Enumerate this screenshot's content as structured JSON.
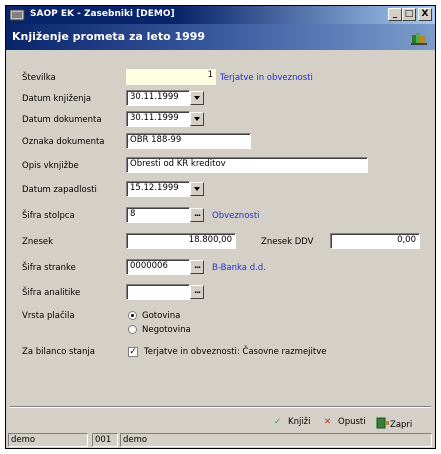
{
  "window": {
    "title": "SAOP  EK - Zasebniki [DEMO]",
    "controls": {
      "minimize": "_",
      "maximize": "□",
      "close": "X"
    }
  },
  "header": {
    "title": "Knjiženje prometa za leto 1999"
  },
  "form": {
    "stevilka": {
      "label": "Številka",
      "value": "1",
      "note": "Terjatve in obveznosti"
    },
    "datum_knjizenja": {
      "label": "Datum knjiženja",
      "value": "30.11.1999"
    },
    "datum_dokumenta": {
      "label": "Datum dokumenta",
      "value": "30.11.1999"
    },
    "oznaka_dokumenta": {
      "label": "Oznaka dokumenta",
      "value": "OBR 188-99"
    },
    "opis_vknjizbe": {
      "label": "Opis vknjižbe",
      "value": "Obresti od KR kreditov"
    },
    "datum_zapadlosti": {
      "label": "Datum zapadlosti",
      "value": "15.12.1999"
    },
    "sifra_stolpca": {
      "label": "Šifra stolpca",
      "value": "8",
      "note": "Obveznosti"
    },
    "znesek": {
      "label": "Znesek",
      "value": "18.800,00"
    },
    "znesek_ddv": {
      "label": "Znesek DDV",
      "value": "0,00"
    },
    "sifra_stranke": {
      "label": "Šifra stranke",
      "value": "0000006",
      "note": "B-Banka d.d."
    },
    "sifra_analitike": {
      "label": "Šifra analitike",
      "value": ""
    },
    "vrsta_placila": {
      "label": "Vrsta plačila",
      "options": [
        "Gotovina",
        "Negotovina"
      ],
      "selected": "Gotovina"
    },
    "za_bilanco": {
      "label": "Za bilanco stanja",
      "checked": true,
      "text": "Terjatve in obveznosti: Časovne razmejitve"
    }
  },
  "actions": {
    "knjizi": "Knjiži",
    "opusti": "Opusti",
    "zapri": "Zapri"
  },
  "statusbar": {
    "user": "demo",
    "code": "001",
    "name": "demo"
  },
  "colors": {
    "title_start": "#0a246a",
    "title_end": "#a6caf0",
    "link": "#1f2fd0",
    "ok": "#2e9e2e",
    "cancel": "#d02020"
  }
}
